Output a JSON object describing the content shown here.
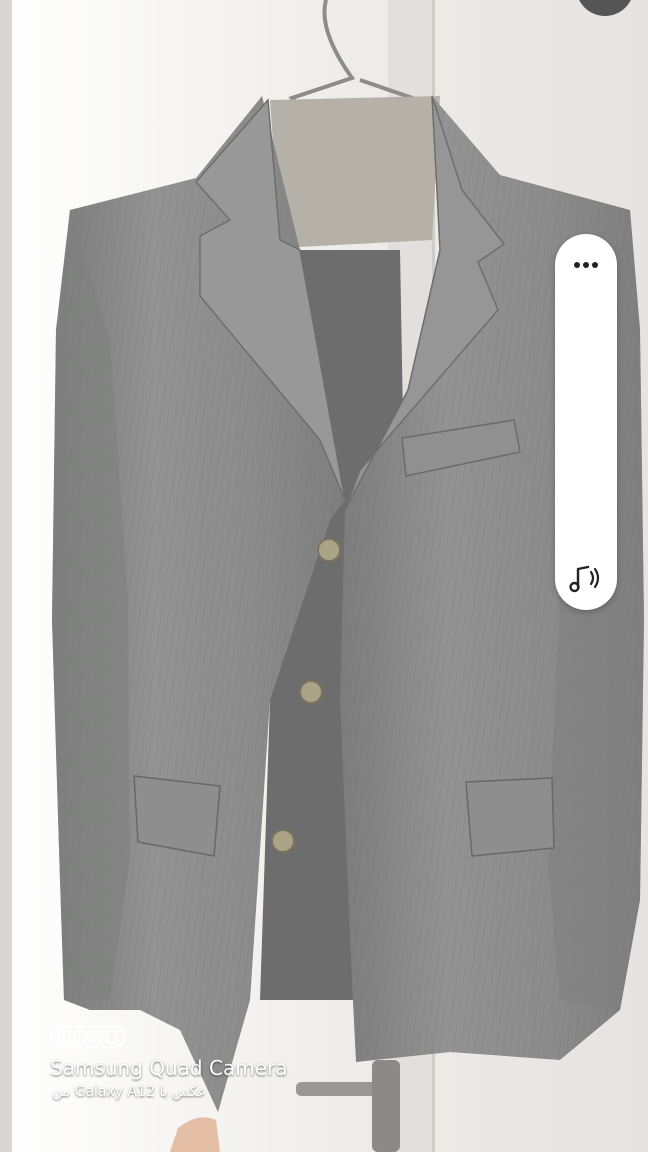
{
  "photo": {
    "subject": "grey pinstripe suit jacket on a hanger against a white door",
    "colors": {
      "door": "#eceae6",
      "jacket": "#8a8b8a",
      "jacket_dark": "#6e6f6e",
      "lining": "#b3afa6",
      "buttons": "#a8a082"
    }
  },
  "side_panel": {
    "more_icon": "more-horizontal-icon",
    "sound_icon": "music-note-sound-icon"
  },
  "watermark": {
    "logo_icon": "camera-lenses-icon",
    "line1": "Samsung Quad Camera",
    "line2": "عکس با Galaxy A12 من"
  }
}
